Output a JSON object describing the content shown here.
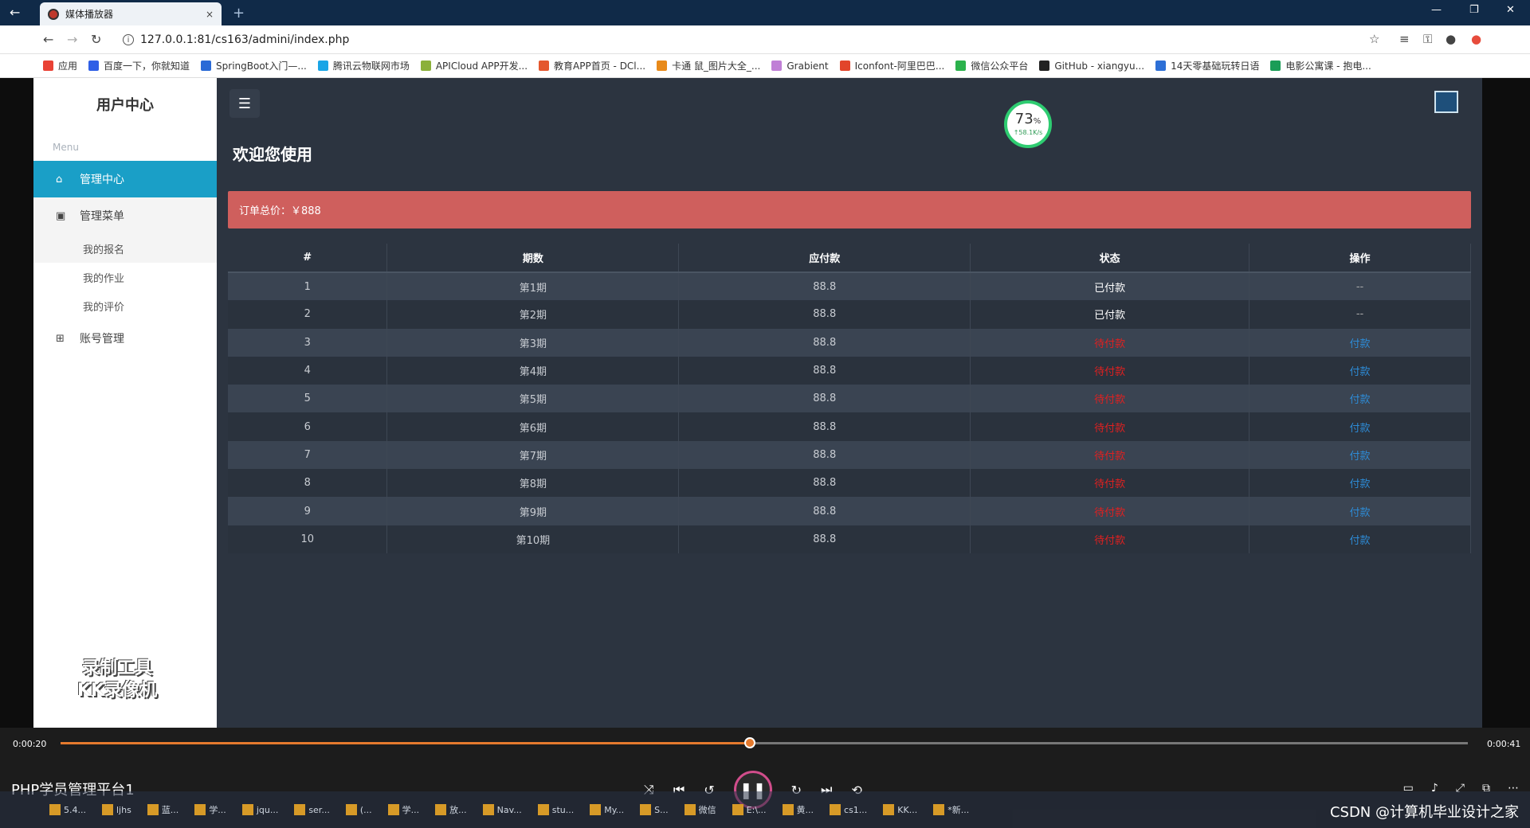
{
  "browser": {
    "tab_title": "媒体播放器",
    "tab_close": "×",
    "new_tab": "+",
    "url": "127.0.0.1:81/cs163/admini/index.php",
    "bookmarks": [
      {
        "label": "应用",
        "color": "#e94235"
      },
      {
        "label": "百度一下，你就知道",
        "color": "#2f5fe6"
      },
      {
        "label": "SpringBoot入门—...",
        "color": "#2a6ad6"
      },
      {
        "label": "腾讯云物联网市场",
        "color": "#1aa5e6"
      },
      {
        "label": "APICloud APP开发...",
        "color": "#8bb03a"
      },
      {
        "label": "教育APP首页 - DCl...",
        "color": "#e4572e"
      },
      {
        "label": "卡通 鼠_图片大全_...",
        "color": "#e88a1a"
      },
      {
        "label": "Grabient",
        "color": "#c07fd6"
      },
      {
        "label": "Iconfont-阿里巴巴...",
        "color": "#e2452b"
      },
      {
        "label": "微信公众平台",
        "color": "#2bb24c"
      },
      {
        "label": "GitHub - xiangyu...",
        "color": "#222222"
      },
      {
        "label": "14天零基础玩转日语",
        "color": "#2d6fd6"
      },
      {
        "label": "电影公寓课 - 抱电...",
        "color": "#1a9d57"
      }
    ]
  },
  "sidebar": {
    "brand": "用户中心",
    "menu_label": "Menu",
    "items": [
      {
        "label": "管理中心",
        "icon": "home-icon"
      },
      {
        "label": "管理菜单",
        "icon": "calendar-icon"
      },
      {
        "label": "账号管理",
        "icon": "plus-square-icon"
      }
    ],
    "sub_items": [
      "我的报名",
      "我的作业",
      "我的评价"
    ],
    "watermark": [
      "录制工具",
      "KK录像机"
    ]
  },
  "main": {
    "speed_pct": "73",
    "speed_unit": "%",
    "speed_rate": "↑58.1K/s",
    "welcome": "欢迎您使用",
    "alert": "订单总价：￥888",
    "table": {
      "headers": [
        "#",
        "期数",
        "应付款",
        "状态",
        "操作"
      ],
      "rows": [
        {
          "no": "1",
          "period": "第1期",
          "amount": "88.8",
          "status": "已付款",
          "action": "--",
          "paid": true
        },
        {
          "no": "2",
          "period": "第2期",
          "amount": "88.8",
          "status": "已付款",
          "action": "--",
          "paid": true
        },
        {
          "no": "3",
          "period": "第3期",
          "amount": "88.8",
          "status": "待付款",
          "action": "付款",
          "paid": false
        },
        {
          "no": "4",
          "period": "第4期",
          "amount": "88.8",
          "status": "待付款",
          "action": "付款",
          "paid": false
        },
        {
          "no": "5",
          "period": "第5期",
          "amount": "88.8",
          "status": "待付款",
          "action": "付款",
          "paid": false
        },
        {
          "no": "6",
          "period": "第6期",
          "amount": "88.8",
          "status": "待付款",
          "action": "付款",
          "paid": false
        },
        {
          "no": "7",
          "period": "第7期",
          "amount": "88.8",
          "status": "待付款",
          "action": "付款",
          "paid": false
        },
        {
          "no": "8",
          "period": "第8期",
          "amount": "88.8",
          "status": "待付款",
          "action": "付款",
          "paid": false
        },
        {
          "no": "9",
          "period": "第9期",
          "amount": "88.8",
          "status": "待付款",
          "action": "付款",
          "paid": false
        },
        {
          "no": "10",
          "period": "第10期",
          "amount": "88.8",
          "status": "待付款",
          "action": "付款",
          "paid": false
        }
      ]
    }
  },
  "player": {
    "elapsed": "0:00:20",
    "total": "0:00:41",
    "progress": 0.49,
    "title": "PHP学员管理平台1"
  },
  "taskbar": {
    "items": [
      "5.4...",
      "ljhs",
      "蓝...",
      "学...",
      "jqu...",
      "ser...",
      "(...",
      "学...",
      "放...",
      "Nav...",
      "stu...",
      "My...",
      "S...",
      "微信",
      "E:\\...",
      "黄...",
      "cs1...",
      "KK...",
      "*新..."
    ]
  },
  "overlay_text": "CSDN @计算机毕业设计之家"
}
